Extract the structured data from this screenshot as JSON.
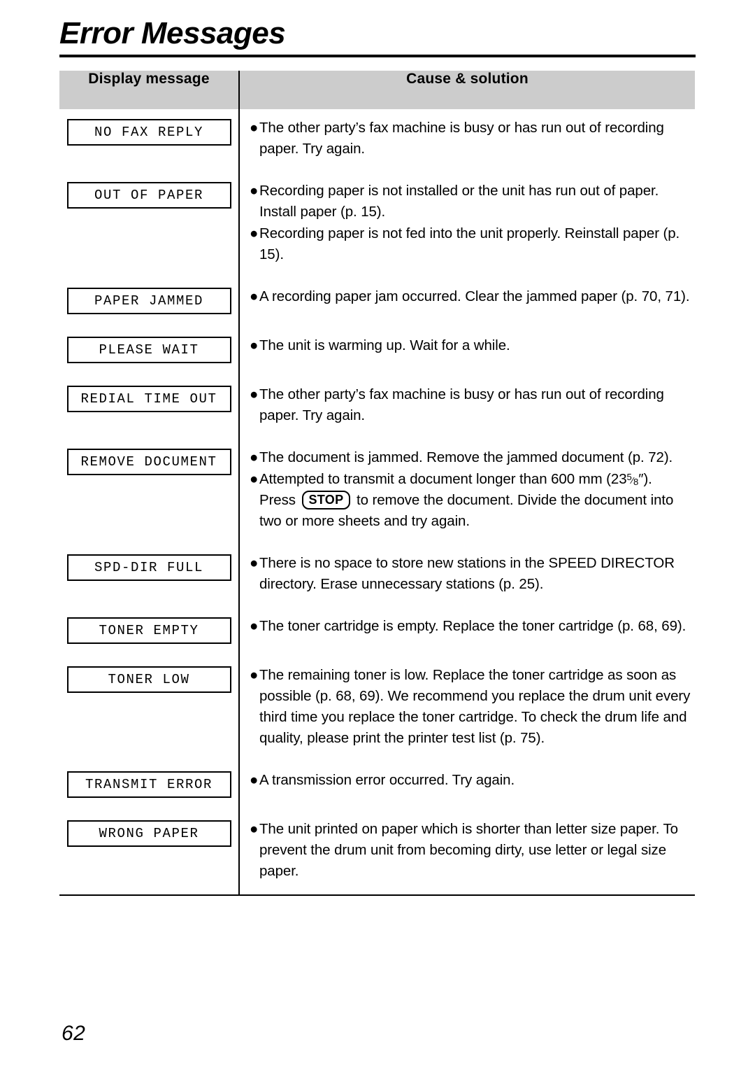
{
  "page": {
    "title": "Error Messages",
    "number": "62"
  },
  "table": {
    "headers": {
      "display_message": "Display message",
      "cause_solution": "Cause & solution"
    },
    "rows": [
      {
        "display": "NO FAX REPLY",
        "causes": [
          {
            "bullet": "●",
            "text": "The other party’s fax machine is busy or has run out of recording paper. Try again."
          }
        ]
      },
      {
        "display": "OUT OF PAPER",
        "causes": [
          {
            "bullet": "●",
            "text": "Recording paper is not installed or the unit has run out of paper. Install paper (p. 15)."
          },
          {
            "bullet": "●",
            "text": "Recording paper is not fed into the unit properly. Reinstall paper (p. 15)."
          }
        ]
      },
      {
        "display": "PAPER JAMMED",
        "causes": [
          {
            "bullet": "●",
            "text": "A recording paper jam occurred. Clear the jammed paper (p. 70, 71)."
          }
        ]
      },
      {
        "display": "PLEASE WAIT",
        "causes": [
          {
            "bullet": "●",
            "text": "The unit is warming up. Wait for a while."
          }
        ]
      },
      {
        "display": "REDIAL TIME OUT",
        "causes": [
          {
            "bullet": "●",
            "text": "The other party’s fax machine is busy or has run out of recording paper. Try again."
          }
        ]
      },
      {
        "display": "REMOVE DOCUMENT",
        "causes": [
          {
            "bullet": "●",
            "text": "The document is jammed. Remove the jammed document (p. 72)."
          },
          {
            "bullet": "●",
            "rich": true,
            "text_part1": "Attempted to transmit a document longer than 600 mm (23",
            "fraction": {
              "numerator": "5",
              "slash": "⁄",
              "denominator": "8"
            },
            "text_part2": "″). Press ",
            "key_label": "STOP",
            "text_part3": " to remove the document. Divide the document into two or more sheets and try again."
          }
        ]
      },
      {
        "display": "SPD-DIR FULL",
        "causes": [
          {
            "bullet": "●",
            "text": "There is no space to store new stations in the SPEED DIRECTOR directory. Erase unnecessary stations (p. 25)."
          }
        ]
      },
      {
        "display": "TONER EMPTY",
        "causes": [
          {
            "bullet": "●",
            "text": "The toner cartridge is empty. Replace the toner cartridge (p. 68, 69)."
          }
        ]
      },
      {
        "display": "TONER LOW",
        "causes": [
          {
            "bullet": "●",
            "text": "The remaining toner is low. Replace the toner cartridge as soon as possible (p. 68, 69). We recommend you replace the drum unit every third time you replace the toner cartridge. To check the drum life and quality, please print the printer test list (p. 75)."
          }
        ]
      },
      {
        "display": "TRANSMIT ERROR",
        "causes": [
          {
            "bullet": "●",
            "text": "A transmission error occurred. Try again."
          }
        ]
      },
      {
        "display": "WRONG PAPER",
        "causes": [
          {
            "bullet": "●",
            "text": "The unit printed on paper which is shorter than letter size paper. To prevent the drum unit from becoming dirty, use letter or legal size paper."
          }
        ]
      }
    ]
  },
  "colors": {
    "header_background": "#cccccc",
    "rule": "#000000",
    "text": "#000000",
    "page_background": "#ffffff"
  }
}
